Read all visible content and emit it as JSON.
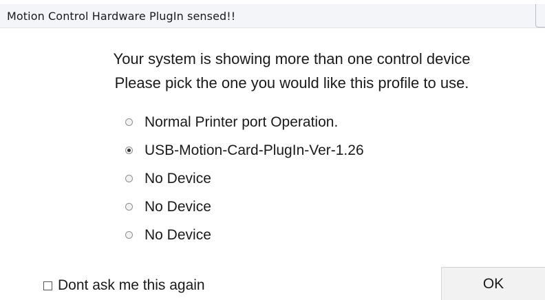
{
  "window": {
    "title": "Motion Control Hardware PlugIn sensed!!"
  },
  "prompt": {
    "line1": "Your system is showing more than one control device",
    "line2": "Please pick the one you would like this profile to use."
  },
  "options": [
    {
      "label": "Normal Printer port Operation.",
      "selected": false
    },
    {
      "label": "USB-Motion-Card-PlugIn-Ver-1.26",
      "selected": true
    },
    {
      "label": "No Device",
      "selected": false
    },
    {
      "label": "No Device",
      "selected": false
    },
    {
      "label": "No Device",
      "selected": false
    }
  ],
  "dont_ask": {
    "label": "Dont ask me this again",
    "checked": false
  },
  "ok_button": {
    "label": "OK"
  }
}
